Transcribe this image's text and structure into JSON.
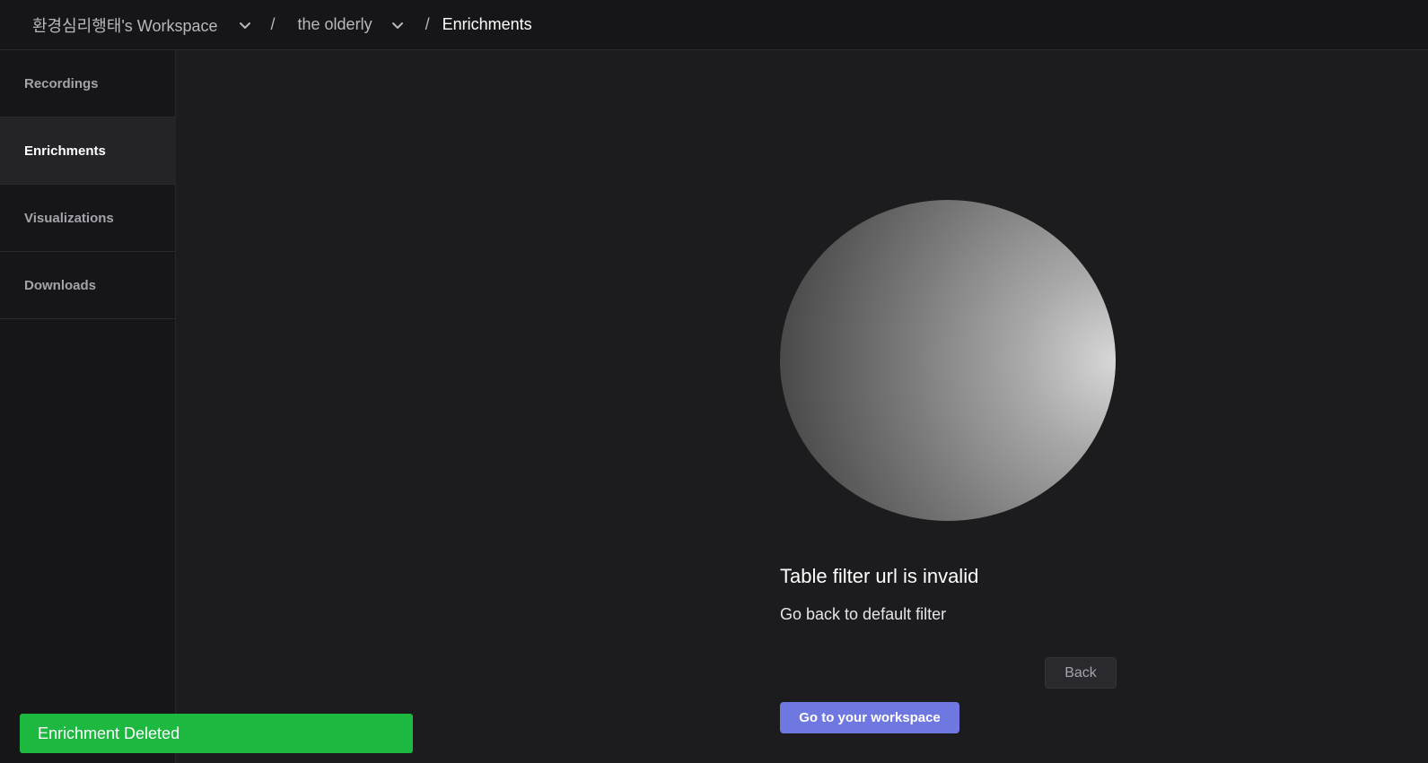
{
  "header": {
    "workspace_label": "환경심리행태's Workspace",
    "separator": "/",
    "project_label": "the olderly",
    "current_label": "Enrichments"
  },
  "sidebar": {
    "items": [
      {
        "label": "Recordings"
      },
      {
        "label": "Enrichments",
        "active": true
      },
      {
        "label": "Visualizations"
      },
      {
        "label": "Downloads"
      }
    ]
  },
  "main": {
    "title": "Table filter url is invalid",
    "subtitle": "Go back to default filter",
    "back_label": "Back",
    "workspace_button_label": "Go to your workspace"
  },
  "toast": {
    "message": "Enrichment Deleted",
    "color": "#1db83f"
  },
  "colors": {
    "accent": "#6f78e0",
    "background": "#1c1c1f",
    "sidebar_bg": "#161618"
  },
  "icons": {
    "workspace_dropdown": "chevron-down-icon",
    "project_dropdown": "chevron-down-icon"
  }
}
